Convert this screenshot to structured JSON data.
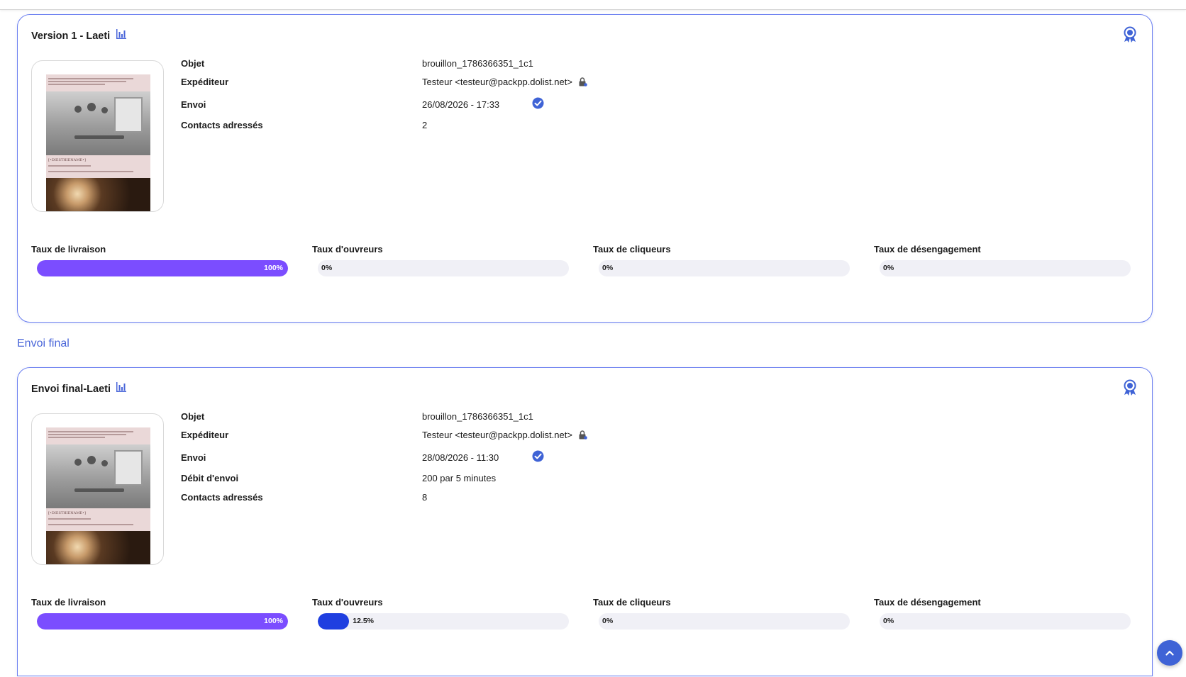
{
  "section_title": "Envoi final",
  "cards": [
    {
      "title": "Version 1 - Laeti",
      "info": [
        {
          "label": "Objet",
          "value": "brouillon_1786366351_1c1"
        },
        {
          "label": "Expéditeur",
          "value": "Testeur <testeur@packpp.dolist.net>"
        },
        {
          "label": "Envoi",
          "value": "26/08/2026 - 17:33"
        },
        {
          "label": "Contacts adressés",
          "value": "2"
        }
      ],
      "stats": [
        {
          "label": "Taux de livraison",
          "value_text": "100%",
          "value": 100
        },
        {
          "label": "Taux d'ouvreurs",
          "value_text": "0%",
          "value": 0
        },
        {
          "label": "Taux de cliqueurs",
          "value_text": "0%",
          "value": 0
        },
        {
          "label": "Taux de désengagement",
          "value_text": "0%",
          "value": 0
        }
      ]
    },
    {
      "title": "Envoi final-Laeti",
      "info": [
        {
          "label": "Objet",
          "value": "brouillon_1786366351_1c1"
        },
        {
          "label": "Expéditeur",
          "value": "Testeur <testeur@packpp.dolist.net>"
        },
        {
          "label": "Envoi",
          "value": "28/08/2026 - 11:30"
        },
        {
          "label": "Débit d'envoi",
          "value": "200 par 5 minutes"
        },
        {
          "label": "Contacts adressés",
          "value": "8"
        }
      ],
      "stats": [
        {
          "label": "Taux de livraison",
          "value_text": "100%",
          "value": 100
        },
        {
          "label": "Taux d'ouvreurs",
          "value_text": "12.5%",
          "value": 12.5
        },
        {
          "label": "Taux de cliqueurs",
          "value_text": "0%",
          "value": 0
        },
        {
          "label": "Taux de désengagement",
          "value_text": "0%",
          "value": 0
        }
      ]
    }
  ],
  "thumbnail_caption": "[•DIESTHIENAME•]",
  "colors": {
    "delivery_bar": "#7b4dff",
    "opens_bar": "#1f3fe0",
    "accent": "#4a66d9",
    "verified_check": "#3f63d6"
  },
  "icons": {
    "stats": "bar-chart-icon",
    "award": "award-ribbon-icon",
    "verified": "check-circle-icon",
    "sender_lock": "lock-icon",
    "scroll": "chevron-up-icon"
  }
}
